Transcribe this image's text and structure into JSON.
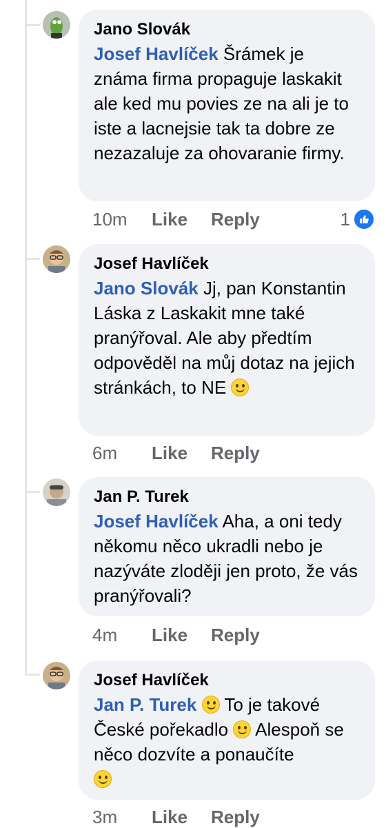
{
  "comments": [
    {
      "author": "Jano Slovák",
      "mention": "Josef Havlíček",
      "text": "Šrámek je známa firma propaguje laskakit ale ked mu povies ze na ali je to iste a lacnejsie tak ta dobre ze nezazaluje za ohovaranie firmy.",
      "time": "10m",
      "like_label": "Like",
      "reply_label": "Reply",
      "reaction_count": "1"
    },
    {
      "author": "Josef Havlíček",
      "mention": "Jano Slovák",
      "text": "Jj, pan Konstantin Láska z Laskakit mne také pranýřoval. Ale aby předtím odpověděl na můj dotaz na jejich stránkách, to NE",
      "time": "6m",
      "like_label": "Like",
      "reply_label": "Reply"
    },
    {
      "author": "Jan P. Turek",
      "mention": "Josef Havlíček",
      "text": "Aha, a oni tedy někomu něco ukradli nebo je nazýváte zloději jen proto, že vás pranýřovali?",
      "time": "4m",
      "like_label": "Like",
      "reply_label": "Reply"
    },
    {
      "author": "Josef Havlíček",
      "mention": "Jan P. Turek",
      "text_a": "To je takové České pořekadlo",
      "text_b": "Alespoň se něco dozvíte a ponaučíte",
      "time": "3m",
      "like_label": "Like",
      "reply_label": "Reply"
    }
  ],
  "colors": {
    "mention": "#2f5fb3",
    "bubble": "#f0f2f5",
    "meta": "#65676b",
    "like_badge": "#1877f2"
  },
  "icons": [
    "smiley-emoji-icon",
    "like-thumb-icon"
  ]
}
